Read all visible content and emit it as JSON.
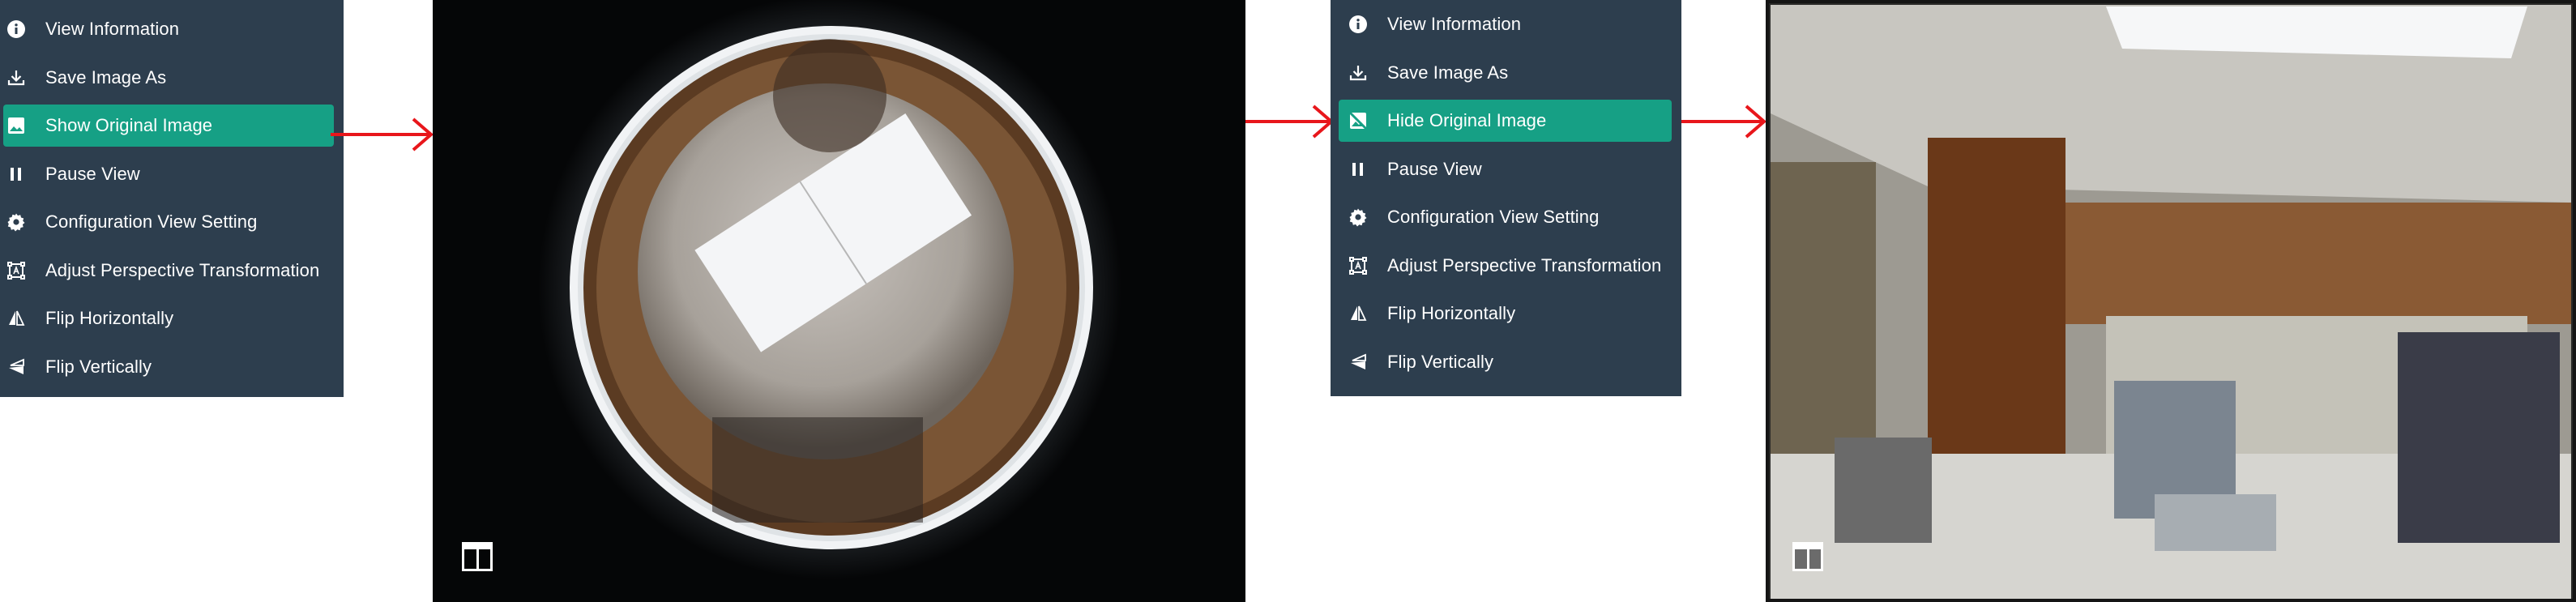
{
  "menu_left": {
    "items": [
      {
        "label": "View Information",
        "icon": "info-icon"
      },
      {
        "label": "Save Image As",
        "icon": "download-icon"
      },
      {
        "label": "Show Original Image",
        "icon": "image-icon",
        "active": true
      },
      {
        "label": "Pause View",
        "icon": "pause-icon"
      },
      {
        "label": "Configuration View Setting",
        "icon": "gear-icon"
      },
      {
        "label": "Adjust Perspective Transformation",
        "icon": "perspective-icon"
      },
      {
        "label": "Flip Horizontally",
        "icon": "flip-horizontal-icon"
      },
      {
        "label": "Flip Vertically",
        "icon": "flip-vertical-icon"
      }
    ]
  },
  "menu_right": {
    "items": [
      {
        "label": "View Information",
        "icon": "info-icon"
      },
      {
        "label": "Save Image As",
        "icon": "download-icon"
      },
      {
        "label": "Hide Original Image",
        "icon": "hide-image-icon",
        "active": true
      },
      {
        "label": "Pause View",
        "icon": "pause-icon"
      },
      {
        "label": "Configuration View Setting",
        "icon": "gear-icon"
      },
      {
        "label": "Adjust Perspective Transformation",
        "icon": "perspective-icon"
      },
      {
        "label": "Flip Horizontally",
        "icon": "flip-horizontal-icon"
      },
      {
        "label": "Flip Vertically",
        "icon": "flip-vertical-icon"
      }
    ]
  },
  "colors": {
    "menu_bg": "#2d3e4e",
    "active_bg": "#16a085",
    "arrow": "#e8161b"
  }
}
